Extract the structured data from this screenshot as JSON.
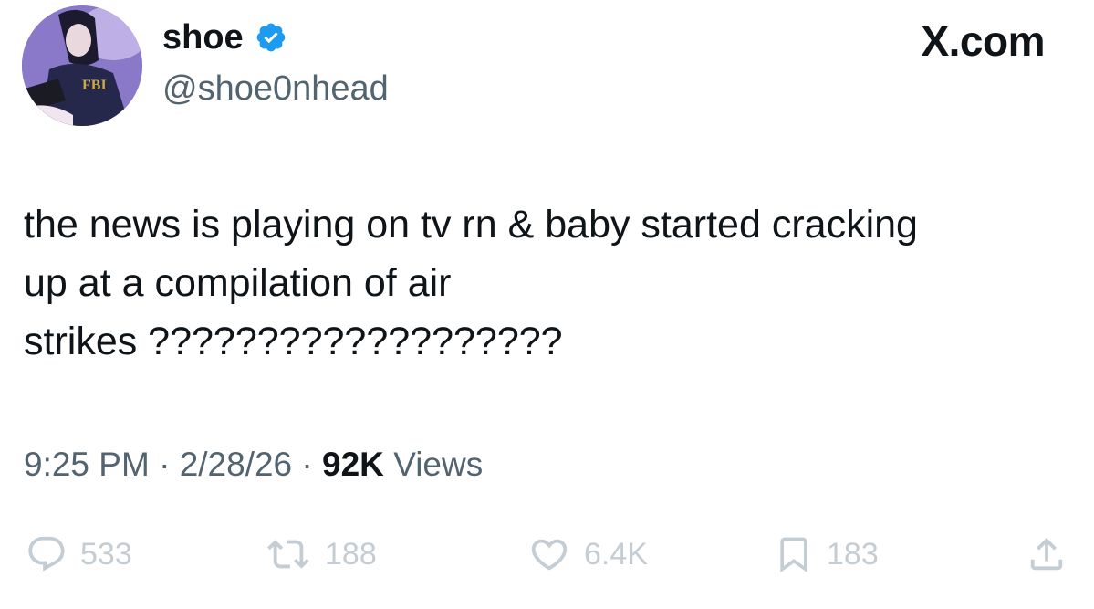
{
  "author": {
    "display_name": "shoe",
    "handle": "@shoe0nhead",
    "verified_icon": "verified-badge-icon"
  },
  "site_label": "X.com",
  "tweet": {
    "text": "the news is playing on tv rn & baby started cracking\nup at a compilation of air\nstrikes ???????????????????"
  },
  "meta": {
    "time": "9:25 PM",
    "separator": "·",
    "date": "2/28/26",
    "views_count": "92K",
    "views_label": "Views"
  },
  "actions": {
    "replies": "533",
    "reposts": "188",
    "likes": "6.4K",
    "bookmarks": "183"
  },
  "colors": {
    "verified": "#1d9bf0",
    "secondary_text": "#536471",
    "action_icons": "#c4cdd4"
  }
}
